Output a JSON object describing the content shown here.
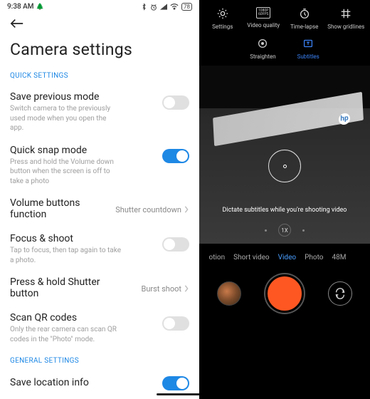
{
  "statusbar": {
    "time": "9:38 AM",
    "battery": "78"
  },
  "header": {
    "title": "Camera settings"
  },
  "sections": {
    "quick": "QUICK SETTINGS",
    "general": "GENERAL SETTINGS"
  },
  "settings": {
    "save_prev": {
      "title": "Save previous mode",
      "desc": "Switch camera to the previously used mode when you open the app.",
      "on": false
    },
    "quick_snap": {
      "title": "Quick snap mode",
      "desc": "Press and hold the Volume down button when the screen is off to take a photo",
      "on": true
    },
    "volume_buttons": {
      "title": "Volume buttons function",
      "value": "Shutter countdown"
    },
    "focus_shoot": {
      "title": "Focus & shoot",
      "desc": "Tap to focus, then tap again to take a photo.",
      "on": false
    },
    "press_hold": {
      "title": "Press & hold Shutter button",
      "value": "Burst shoot"
    },
    "scan_qr": {
      "title": "Scan QR codes",
      "desc": "Only the rear camera can scan QR codes in the \"Photo\" mode.",
      "on": false
    },
    "save_location": {
      "title": "Save location info",
      "on": true
    }
  },
  "camera": {
    "top": {
      "settings": "Settings",
      "video_quality": "Video quality",
      "video_quality_badge": "1080P\n60FPS",
      "time_lapse": "Time-lapse",
      "gridlines": "Show gridlines",
      "straighten": "Straighten",
      "subtitles": "Subtitles"
    },
    "hint": "Dictate subtitles while you're shooting video",
    "zoom": "1X",
    "modes": {
      "m0": "otion",
      "m1": "Short video",
      "m2": "Video",
      "m3": "Photo",
      "m4": "48M"
    }
  }
}
